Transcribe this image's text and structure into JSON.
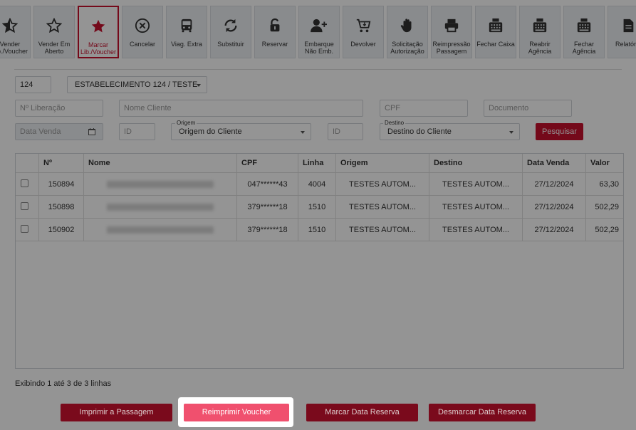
{
  "toolbar": [
    {
      "label": "Vender Lib./Voucher",
      "icon": "star-half-icon"
    },
    {
      "label": "Vender Em Aberto",
      "icon": "star-outline-icon"
    },
    {
      "label": "Marcar Lib./Voucher",
      "icon": "star-filled-icon",
      "active": true
    },
    {
      "label": "Cancelar",
      "icon": "cancel-circle-icon"
    },
    {
      "label": "Viag. Extra",
      "icon": "bus-icon"
    },
    {
      "label": "Substituir",
      "icon": "refresh-icon"
    },
    {
      "label": "Reservar",
      "icon": "unlock-icon"
    },
    {
      "label": "Embarque Não Emb.",
      "icon": "user-plus-icon"
    },
    {
      "label": "Devolver",
      "icon": "cart-return-icon"
    },
    {
      "label": "Solicitação Autorização",
      "icon": "hand-icon"
    },
    {
      "label": "Reimpressão Passagem",
      "icon": "printer-icon"
    },
    {
      "label": "Fechar Caixa",
      "icon": "cash-register-icon"
    },
    {
      "label": "Reabrir Agência",
      "icon": "cash-register-icon"
    },
    {
      "label": "Fechar Agência",
      "icon": "cash-register-icon"
    },
    {
      "label": "Relatório",
      "icon": "document-icon"
    }
  ],
  "filters": {
    "agency_code": "124",
    "establishment": "ESTABELECIMENTO 124 / TESTE",
    "liberacao_placeholder": "Nº Liberação",
    "nome_placeholder": "Nome Cliente",
    "cpf_placeholder": "CPF",
    "documento_placeholder": "Documento",
    "data_venda_placeholder": "Data Venda",
    "id_placeholder": "ID",
    "origem_label": "Origem",
    "origem_value": "Origem do Cliente",
    "destino_label": "Destino",
    "destino_value": "Destino do Cliente",
    "search_button": "Pesquisar"
  },
  "table": {
    "columns": [
      "Nº",
      "Nome",
      "CPF",
      "Linha",
      "Origem",
      "Destino",
      "Data Venda",
      "Valor"
    ],
    "rows": [
      {
        "num": "150894",
        "cpf": "047******43",
        "linha": "4004",
        "origem": "TESTES AUTOM...",
        "destino": "TESTES AUTOM...",
        "data": "27/12/2024",
        "valor": "63,30"
      },
      {
        "num": "150898",
        "cpf": "379******18",
        "linha": "1510",
        "origem": "TESTES AUTOM...",
        "destino": "TESTES AUTOM...",
        "data": "27/12/2024",
        "valor": "502,29"
      },
      {
        "num": "150902",
        "cpf": "379******18",
        "linha": "1510",
        "origem": "TESTES AUTOM...",
        "destino": "TESTES AUTOM...",
        "data": "27/12/2024",
        "valor": "502,29"
      }
    ]
  },
  "footer": {
    "row_count": "Exibindo 1 até 3 de 3 linhas",
    "print_button": "Imprimir a Passagem",
    "reprint_button": "Reimprimir Voucher",
    "mark_date_button": "Marcar Data Reserva",
    "unmark_date_button": "Desmarcar Data Reserva"
  },
  "colors": {
    "accent": "#c8102e",
    "highlight": "#f0506e"
  }
}
